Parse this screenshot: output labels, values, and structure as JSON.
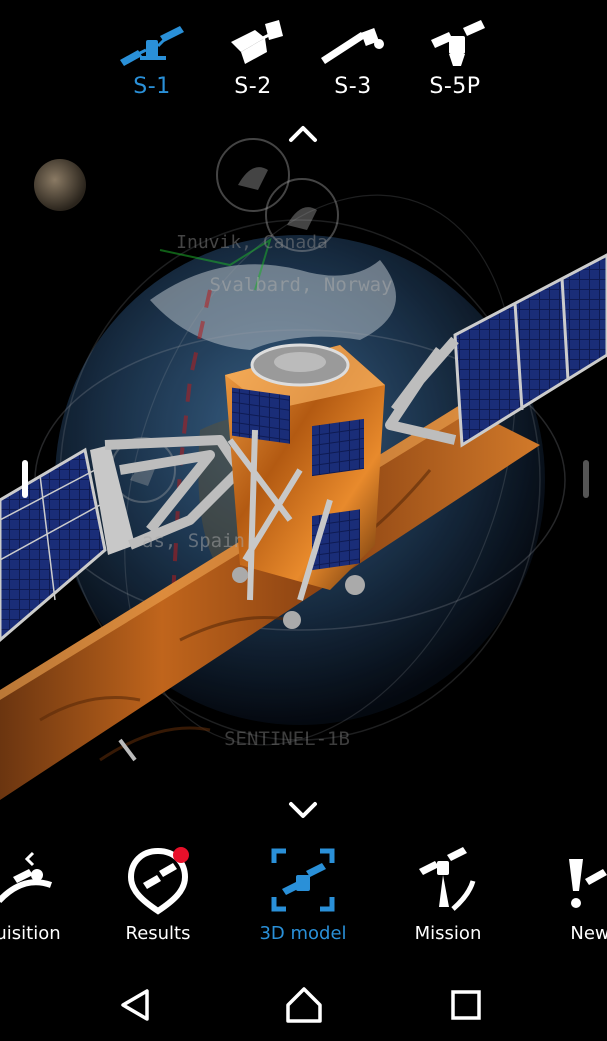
{
  "satellite_tabs": [
    {
      "label": "S-1",
      "icon": "sentinel-1-icon",
      "active": true
    },
    {
      "label": "S-2",
      "icon": "sentinel-2-icon",
      "active": false
    },
    {
      "label": "S-3",
      "icon": "sentinel-3-icon",
      "active": false
    },
    {
      "label": "S-5P",
      "icon": "sentinel-5p-icon",
      "active": false
    }
  ],
  "scene": {
    "ground_stations": [
      "Inuvik, Canada",
      "Svalbard, Norway",
      "Maspalomas, Spain"
    ],
    "station_visible": [
      "Inuvik, Canada",
      "Svalbard, Norway",
      "as, Spain"
    ],
    "satellite_name": "SENTINEL-1B"
  },
  "bottom_nav": [
    {
      "label": "uisition",
      "icon": "acquisition-icon",
      "active": false
    },
    {
      "label": "Results",
      "icon": "results-icon",
      "active": false,
      "badge": true
    },
    {
      "label": "3D model",
      "icon": "3d-model-icon",
      "active": true
    },
    {
      "label": "Mission",
      "icon": "mission-icon",
      "active": false
    },
    {
      "label": "New",
      "icon": "news-icon",
      "active": false
    }
  ],
  "colors": {
    "accent": "#2a90d8",
    "badge": "#e8102a",
    "gold": "#c06a1c"
  }
}
